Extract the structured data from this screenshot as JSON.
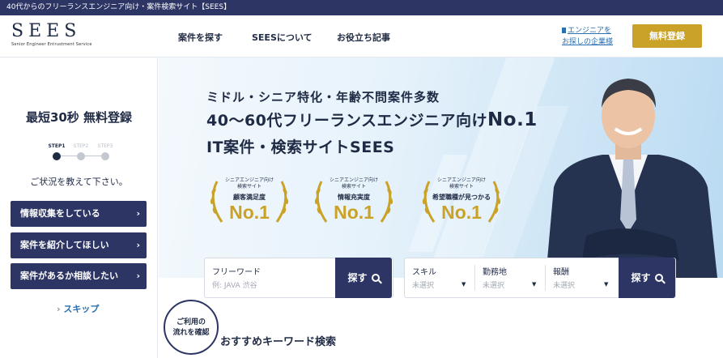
{
  "topbar": {
    "text": "40代からのフリーランスエンジニア向け・案件検索サイト【SEES】"
  },
  "header": {
    "logo": "SEES",
    "logo_sub": "Senior Engineer Entrustment Service",
    "nav": [
      "案件を探す",
      "SEESについて",
      "お役立ち記事"
    ],
    "corp_link_line1": "エンジニアを",
    "corp_link_line2": "お探しの企業様",
    "register_label": "無料登録"
  },
  "sidebar": {
    "title": "最短30秒 無料登録",
    "steps": [
      "STEP1",
      "STEP2",
      "STEP3"
    ],
    "active_step": 1,
    "prompt": "ご状況を教えて下さい。",
    "options": [
      "情報収集をしている",
      "案件を紹介してほしい",
      "案件があるか相談したい"
    ],
    "skip_label": "スキップ"
  },
  "hero": {
    "subtitle": "ミドル・シニア特化・年齢不問案件多数",
    "title_line1": "40〜60代フリーランスエンジニア向け",
    "title_line1_no1": "No.1",
    "title_line2": "IT案件・検索サイトSEES",
    "awards": [
      {
        "cap1": "シニアエンジニア向け",
        "cap2": "検索サイト",
        "label": "顧客満足度",
        "rank": "No.1"
      },
      {
        "cap1": "シニアエンジニア向け",
        "cap2": "検索サイト",
        "label": "情報充実度",
        "rank": "No.1"
      },
      {
        "cap1": "シニアエンジニア向け",
        "cap2": "検索サイト",
        "label": "希望職種が見つかる",
        "rank": "No.1"
      }
    ]
  },
  "search": {
    "free_label": "フリーワード",
    "free_placeholder": "例: JAVA 渋谷",
    "search_label": "探す",
    "selects": [
      {
        "label": "スキル",
        "value": "未選択"
      },
      {
        "label": "勤務地",
        "value": "未選択"
      },
      {
        "label": "報酬",
        "value": "未選択"
      }
    ]
  },
  "flow_badge": {
    "line1": "ご利用の",
    "line2": "流れを確認"
  },
  "keyword_section": {
    "title": "おすすめキーワード検索"
  },
  "colors": {
    "navy": "#2c3564",
    "gold": "#c9a227",
    "link_blue": "#2a6fb0"
  }
}
